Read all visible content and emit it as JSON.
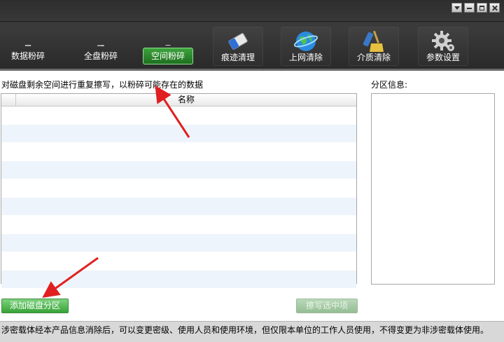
{
  "toolbar": {
    "tabs": [
      {
        "label": "数据粉碎",
        "icon": "shredder-icon"
      },
      {
        "label": "全盘粉碎",
        "icon": "disk-icon"
      },
      {
        "label": "空间粉碎",
        "icon": "space-icon",
        "active": true
      },
      {
        "label": "痕迹清理",
        "icon": "eraser-icon"
      },
      {
        "label": "上网清除",
        "icon": "globe-icon"
      },
      {
        "label": "介质清除",
        "icon": "usb-broom-icon"
      },
      {
        "label": "参数设置",
        "icon": "gear-icon"
      }
    ]
  },
  "main": {
    "description": "对磁盘剩余空间进行重复擦写，以粉碎可能存在的数据",
    "table": {
      "column_name": "名称"
    },
    "partition_label": "分区信息:",
    "add_button": "添加磁盘分区",
    "wipe_button": "擦写选中项"
  },
  "status_bar": "涉密载体经本产品信息消除后，可以变更密级、使用人员和使用环境，但仅限本单位的工作人员使用，不得变更为非涉密载体使用。",
  "colors": {
    "accent_green": "#2e8b2e",
    "arrow_red": "#e02020"
  }
}
